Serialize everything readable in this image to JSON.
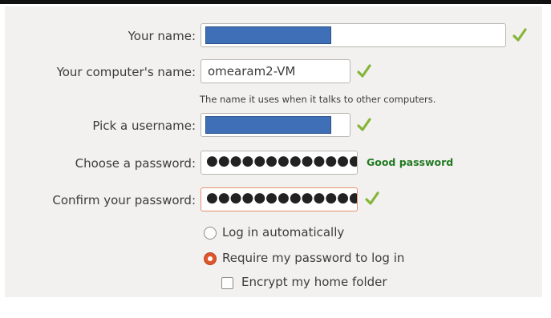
{
  "form": {
    "name": {
      "label": "Your name:",
      "value": "",
      "value_redacted": true,
      "valid": true,
      "valid_icon": "check-mark-icon"
    },
    "computer_name": {
      "label": "Your computer's name:",
      "value": "omearam2-VM",
      "hint": "The name it uses when it talks to other computers.",
      "valid": true,
      "valid_icon": "check-mark-icon"
    },
    "username": {
      "label": "Pick a username:",
      "value": "",
      "value_redacted": true,
      "valid": true,
      "valid_icon": "check-mark-icon"
    },
    "password": {
      "label": "Choose a password:",
      "masked_value": "●●●●●●●●●●●●●",
      "strength": "Good password",
      "strength_color": "#217a21"
    },
    "confirm_password": {
      "label": "Confirm your password:",
      "masked_value": "●●●●●●●●●●●●●",
      "valid": true,
      "valid_icon": "check-mark-icon"
    }
  },
  "login_options": {
    "auto_login": {
      "label": "Log in automatically",
      "selected": false
    },
    "require_password": {
      "label": "Require my password to log in",
      "selected": true
    },
    "encrypt_home": {
      "label": "Encrypt my home folder",
      "checked": false
    }
  },
  "colors": {
    "accent": "#e0562c",
    "check": "#87b53a",
    "redaction": "#3e6fb7",
    "background": "#f2f1f0"
  }
}
